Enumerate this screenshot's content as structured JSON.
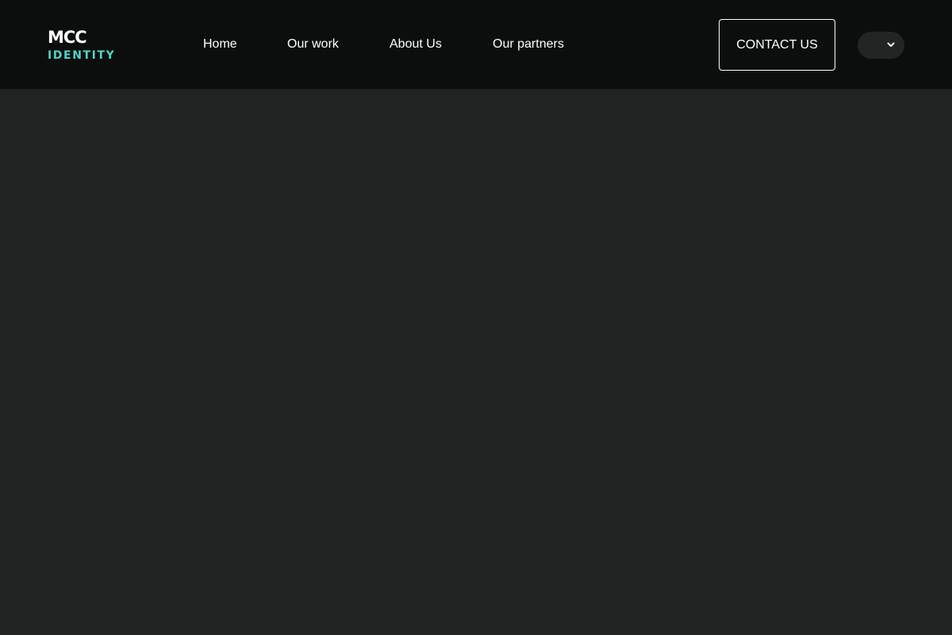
{
  "logo": {
    "line1": "MCC",
    "line2": "IDENTITY",
    "accent_color": "#4fd3c4"
  },
  "nav": {
    "items": [
      {
        "label": "Home"
      },
      {
        "label": "Our work"
      },
      {
        "label": "About Us"
      },
      {
        "label": "Our partners"
      }
    ]
  },
  "header": {
    "contact_label": "CONTACT US",
    "language_icon": "chevron-down-icon"
  },
  "colors": {
    "header_bg": "#0c0e0e",
    "page_bg": "#212222",
    "text": "#ffffff"
  }
}
